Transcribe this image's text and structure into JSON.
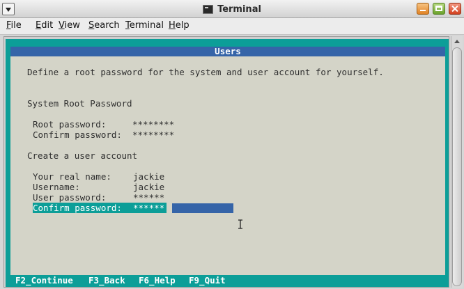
{
  "window": {
    "title": "Terminal"
  },
  "menu": [
    "File",
    "Edit",
    "View",
    "Search",
    "Terminal",
    "Help"
  ],
  "screen": {
    "header": "Users",
    "intro": "Define a root password for the system and user account for yourself.",
    "root_section_title": "System Root Password",
    "root_fields": [
      {
        "label": "Root password:",
        "value": "********"
      },
      {
        "label": "Confirm password:",
        "value": "********"
      }
    ],
    "user_section_title": "Create a user account",
    "user_fields": [
      {
        "label": "Your real name:",
        "value": "jackie"
      },
      {
        "label": "Username:",
        "value": "jackie"
      },
      {
        "label": "User password:",
        "value": "******"
      },
      {
        "label": "Confirm password:",
        "value": "******"
      }
    ],
    "footer_keys": [
      "F2_Continue",
      "F3_Back",
      "F6_Help",
      "F9_Quit"
    ]
  },
  "colors": {
    "terminal_teal": "#0c9e98",
    "header_blue": "#3564a8",
    "content_bg": "#d4d4c8"
  },
  "icons": [
    "window-menu-icon",
    "terminal-icon",
    "minimize-icon",
    "maximize-icon",
    "close-icon",
    "scroll-up-arrow-icon",
    "text-cursor-icon"
  ]
}
